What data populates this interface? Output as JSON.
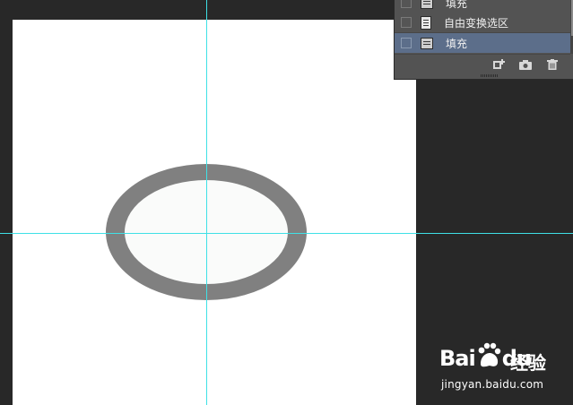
{
  "history_panel": {
    "states": [
      {
        "label": "填充",
        "icon": "fill-state-icon",
        "selected": false
      },
      {
        "label": "自由变换选区",
        "icon": "document-state-icon",
        "selected": false
      },
      {
        "label": "填充",
        "icon": "fill-state-icon",
        "selected": true
      }
    ],
    "footer_icons": [
      "new-document-from-state-icon",
      "camera-icon",
      "trash-icon"
    ]
  },
  "canvas": {
    "background": "#ffffff",
    "ring_color": "#808080",
    "ring_inner_fill": "#fafbfa",
    "guide_color": "#3fe0e6"
  },
  "watermark": {
    "brand_a": "Bai",
    "brand_b": "du",
    "product": "经验",
    "url": "jingyan.baidu.com"
  }
}
